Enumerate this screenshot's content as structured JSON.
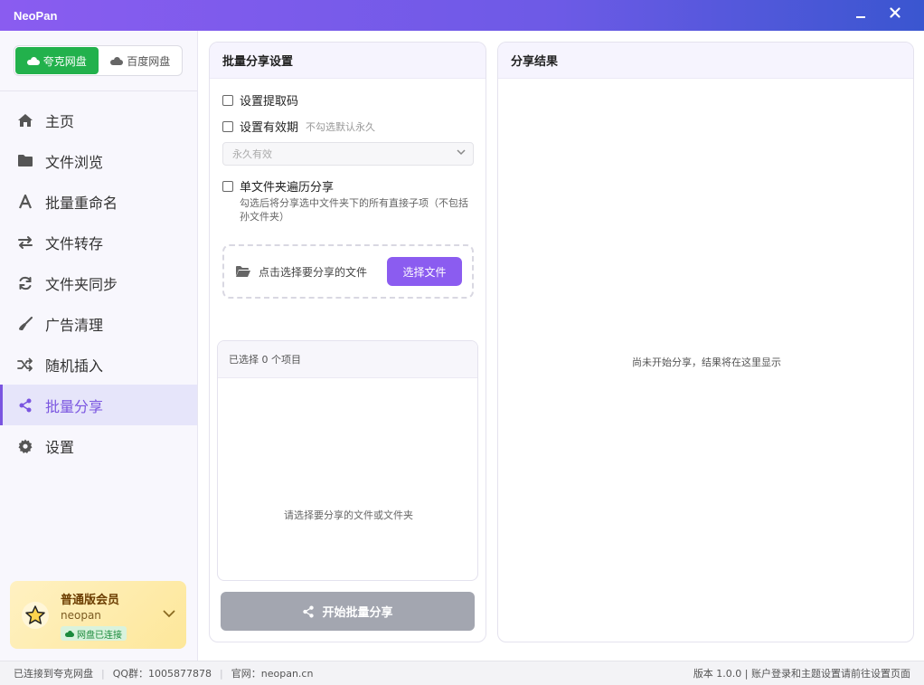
{
  "window": {
    "title": "NeoPan",
    "minimize_icon": "minimize-icon",
    "close_icon": "close-icon"
  },
  "disk_switch": {
    "quark_label": "夸克网盘",
    "baidu_label": "百度网盘",
    "active_color": "#22b14c"
  },
  "sidebar": {
    "items": [
      {
        "label": "主页",
        "icon": "home-icon"
      },
      {
        "label": "文件浏览",
        "icon": "folder-icon"
      },
      {
        "label": "批量重命名",
        "icon": "font-icon"
      },
      {
        "label": "文件转存",
        "icon": "exchange-icon"
      },
      {
        "label": "文件夹同步",
        "icon": "sync-icon"
      },
      {
        "label": "广告清理",
        "icon": "broom-icon"
      },
      {
        "label": "随机插入",
        "icon": "shuffle-icon"
      },
      {
        "label": "批量分享",
        "icon": "share-icon"
      },
      {
        "label": "设置",
        "icon": "gear-icon"
      }
    ],
    "active_index": 7,
    "accent_color": "#7a55e0"
  },
  "member": {
    "title": "普通版会员",
    "username": "neopan",
    "status": "网盘已连接"
  },
  "settings_panel": {
    "title": "批量分享设置",
    "set_code_label": "设置提取码",
    "set_expiry_label": "设置有效期",
    "expiry_hint": "不勾选默认永久",
    "expiry_selected": "永久有效",
    "traverse_label": "单文件夹遍历分享",
    "traverse_desc": "勾选后将分享选中文件夹下的所有直接子项（不包括孙文件夹）",
    "dropzone_text": "点击选择要分享的文件",
    "choose_button": "选择文件",
    "selected_count_text": "已选择 0 个项目",
    "selected_empty": "请选择要分享的文件或文件夹",
    "start_button": "开始批量分享"
  },
  "result_panel": {
    "title": "分享结果",
    "empty_text": "尚未开始分享，结果将在这里显示"
  },
  "statusbar": {
    "connection": "已连接到夸克网盘",
    "qq_group": "QQ群：1005877878",
    "website": "官网：neopan.cn",
    "right_text": "版本 1.0.0 | 账户登录和主题设置请前往设置页面"
  }
}
